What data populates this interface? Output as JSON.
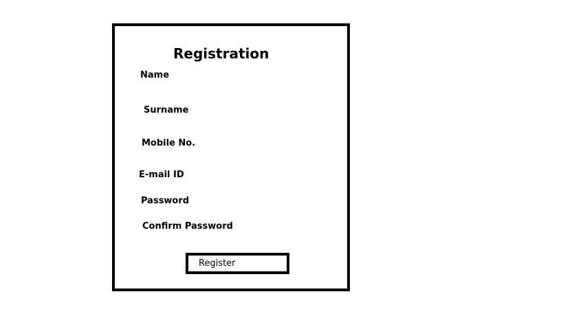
{
  "form": {
    "title": "Registration",
    "fields": {
      "name": "Name",
      "surname": "Surname",
      "mobile": "Mobile No.",
      "email": "E-mail ID",
      "password": "Password",
      "confirm_password": "Confirm Password"
    },
    "register_label": "Register"
  },
  "colors": {
    "border": "#000000",
    "background": "#ffffff",
    "text": "#000000"
  }
}
